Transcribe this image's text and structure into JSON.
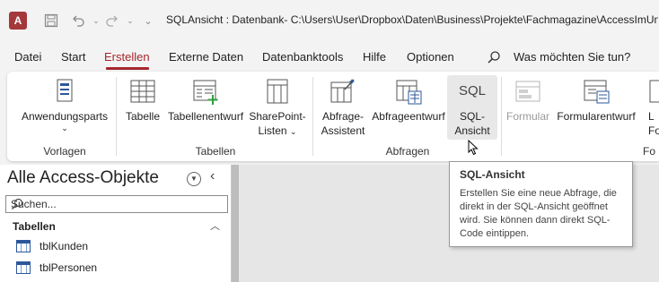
{
  "window": {
    "app_icon": "A",
    "title": "SQLAnsicht : Datenbank- C:\\Users\\User\\Dropbox\\Daten\\Business\\Projekte\\Fachmagazine\\AccessImUn",
    "qat_icons": [
      "save-icon",
      "undo-icon",
      "redo-icon",
      "customize-icon"
    ]
  },
  "menu": {
    "items": [
      "Datei",
      "Start",
      "Erstellen",
      "Externe Daten",
      "Datenbanktools",
      "Hilfe",
      "Optionen"
    ],
    "active": "Erstellen",
    "tell_me": "Was möchten Sie tun?"
  },
  "ribbon": {
    "anwendungsparts": "Anwendungsparts",
    "tabelle": "Tabelle",
    "tabellenentwurf": "Tabellenentwurf",
    "sharepoint_1": "SharePoint-",
    "sharepoint_2": "Listen",
    "abfrage_assistent_1": "Abfrage-",
    "abfrage_assistent_2": "Assistent",
    "abfrageentwurf": "Abfrageentwurf",
    "sql_icon_text": "SQL",
    "sql_ansicht_1": "SQL-",
    "sql_ansicht_2": "Ansicht",
    "formular": "Formular",
    "formularentwurf": "Formularentwurf",
    "partial_1": "L",
    "partial_2": "Fo",
    "groups": {
      "vorlagen": "Vorlagen",
      "tabellen": "Tabellen",
      "abfragen": "Abfragen",
      "formulare_partial": "Fo"
    }
  },
  "tooltip": {
    "title": "SQL-Ansicht",
    "body": "Erstellen Sie eine neue Abfrage, die direkt in der SQL-Ansicht geöffnet wird. Sie können dann direkt SQL-Code eintippen."
  },
  "nav": {
    "title": "Alle Access-Objekte",
    "search_placeholder": "Suchen...",
    "group": "Tabellen",
    "items": [
      "tblKunden",
      "tblPersonen"
    ]
  },
  "colors": {
    "accent": "#a4262c",
    "table_blue": "#2b579a",
    "green": "#2e9e3e"
  }
}
